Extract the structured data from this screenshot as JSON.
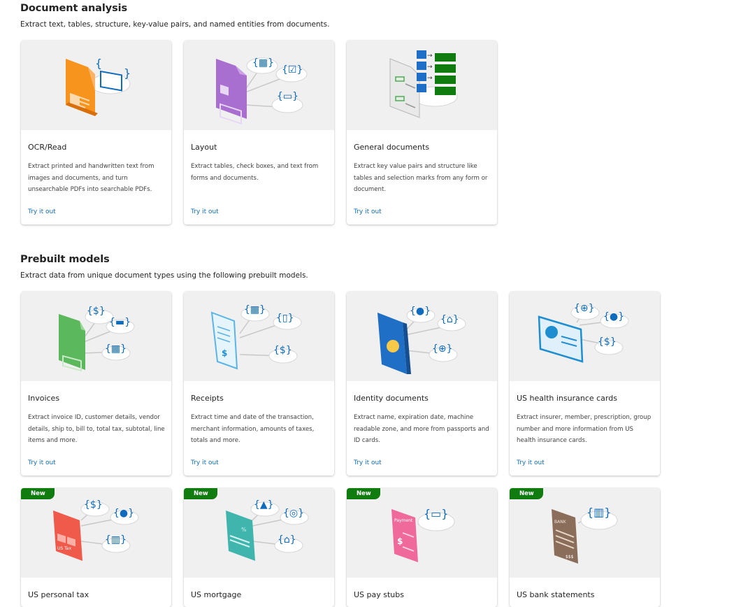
{
  "document_analysis": {
    "title": "Document analysis",
    "description": "Extract text, tables, structure, key-value pairs, and named entities from documents.",
    "cards": [
      {
        "title": "OCR/Read",
        "description": "Extract printed and handwritten text from images and documents, and turn unsearchable PDFs into searchable PDFs.",
        "link": "Try it out"
      },
      {
        "title": "Layout",
        "description": "Extract tables, check boxes, and text from forms and documents.",
        "link": "Try it out"
      },
      {
        "title": "General documents",
        "description": "Extract key value pairs and structure like tables and selection marks from any form or document.",
        "link": "Try it out"
      }
    ]
  },
  "prebuilt_models": {
    "title": "Prebuilt models",
    "description": "Extract data from unique document types using the following prebuilt models.",
    "cards": [
      {
        "title": "Invoices",
        "description": "Extract invoice ID, customer details, vendor details, ship to, bill to, total tax, subtotal, line items and more.",
        "link": "Try it out"
      },
      {
        "title": "Receipts",
        "description": "Extract time and date of the transaction, merchant information, amounts of taxes, totals and more.",
        "link": "Try it out"
      },
      {
        "title": "Identity documents",
        "description": "Extract name, expiration date, machine readable zone, and more from passports and ID cards.",
        "link": "Try it out"
      },
      {
        "title": "US health insurance cards",
        "description": "Extract insurer, member, prescription, group number and more information from US health insurance cards.",
        "link": "Try it out"
      },
      {
        "title": "US personal tax",
        "badge": "New"
      },
      {
        "title": "US mortgage",
        "badge": "New"
      },
      {
        "title": "US pay stubs",
        "badge": "New"
      },
      {
        "title": "US bank statements",
        "badge": "New"
      }
    ]
  },
  "illustration_text": {
    "us_tax": "US Tax",
    "payment": "Payment",
    "bank": "BANK",
    "percent": "%",
    "dollar": "$",
    "dollars": "$$$"
  },
  "colors": {
    "accent": "#0f6cbd",
    "badge": "#107c10",
    "ocr": "#f7941d",
    "layout": "#a86fd1",
    "invoice": "#5cb85c",
    "passport": "#1e6fc5",
    "tax": "#f05a4a",
    "mortgage": "#3fb5ad",
    "paystub": "#ef6a9a",
    "bank": "#8a6d5a"
  }
}
